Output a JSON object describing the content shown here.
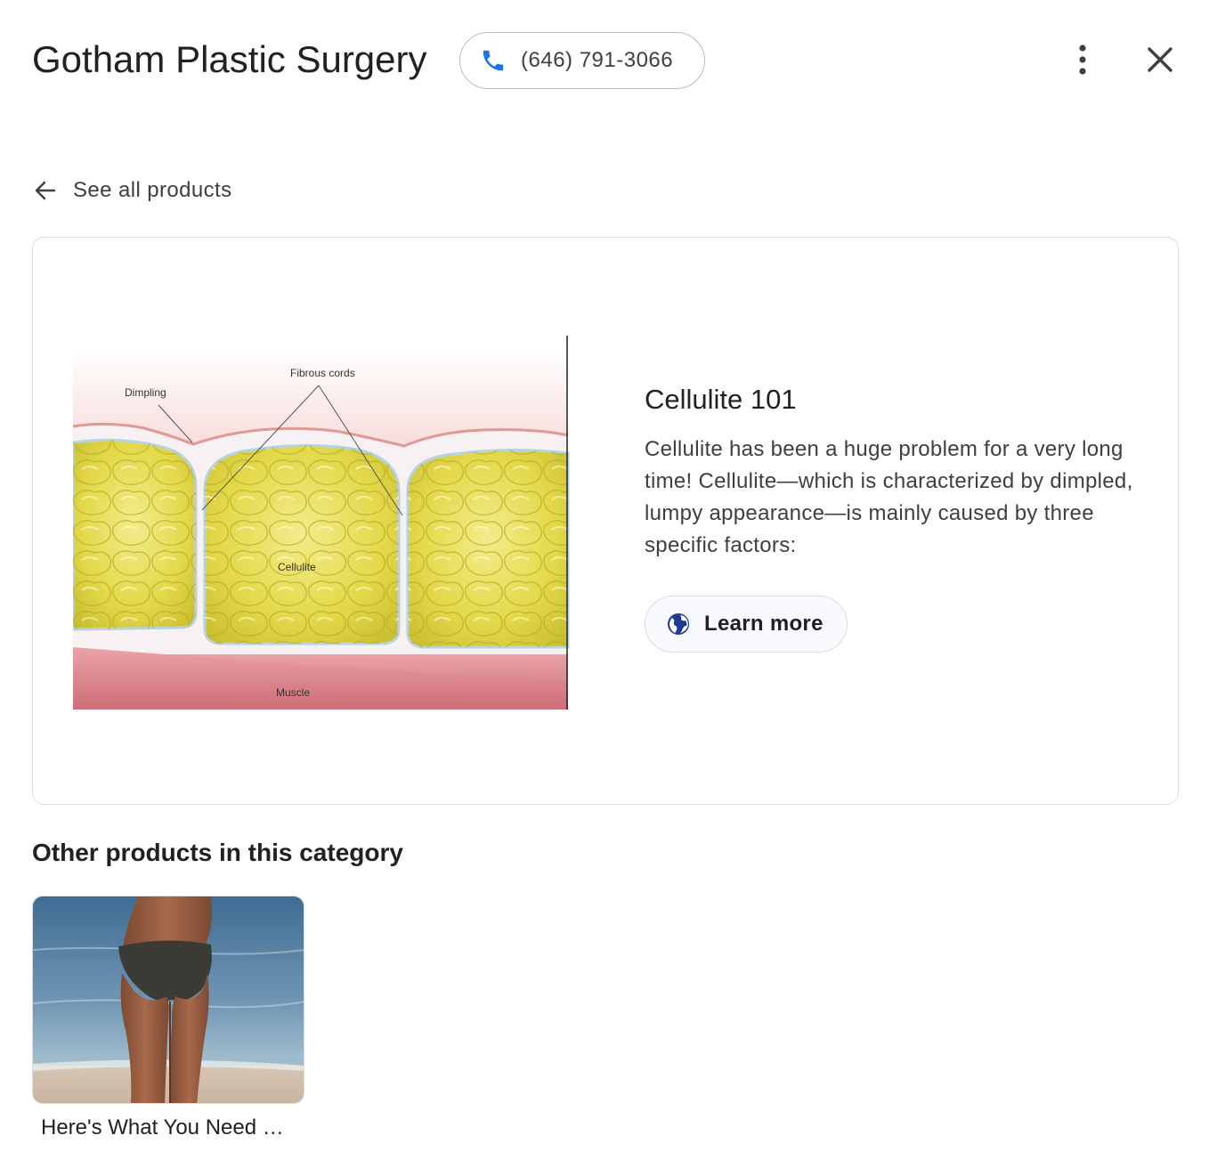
{
  "header": {
    "business_name": "Gotham Plastic Surgery",
    "phone_label": "(646) 791-3066",
    "phone_icon": "phone-icon",
    "more_icon": "more-vert-icon",
    "close_icon": "close-icon"
  },
  "nav": {
    "back_label": "See all products",
    "back_icon": "arrow-back-icon"
  },
  "product": {
    "title": "Cellulite 101",
    "description": "Cellulite has been a huge problem for a very long time! Cellulite—which is characterized by dimpled, lumpy appearance—is mainly caused by three specific factors:",
    "learn_more_label": "Learn more",
    "learn_more_icon": "globe-icon",
    "image_labels": {
      "fibrous_cords": "Fibrous cords",
      "dimpling": "Dimpling",
      "cellulite": "Cellulite",
      "muscle": "Muscle"
    }
  },
  "other_products": {
    "heading": "Other products in this category",
    "items": [
      {
        "caption": "Here's What You Need …"
      }
    ]
  },
  "colors": {
    "phone_icon": "#1a73e8",
    "globe_icon": "#1f3a93",
    "icon_gray": "#5f6368"
  }
}
